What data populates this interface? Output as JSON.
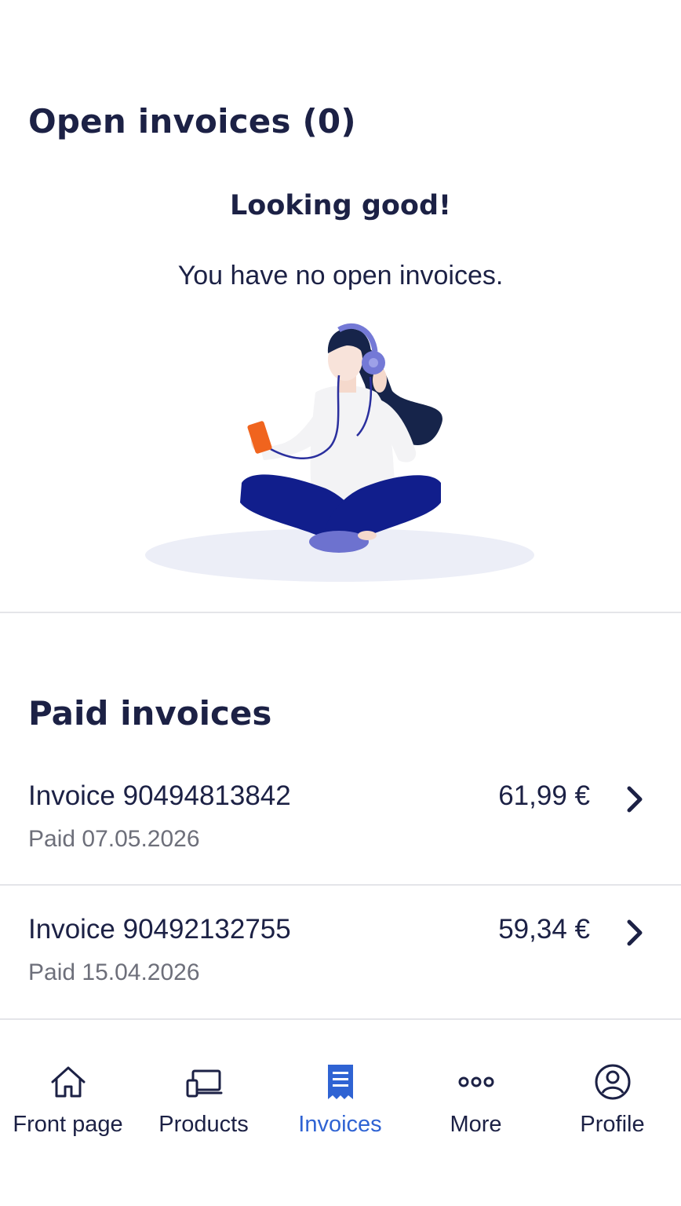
{
  "open_section": {
    "title": "Open invoices (0)",
    "empty_heading": "Looking good!",
    "empty_message": "You have no open invoices."
  },
  "paid_section": {
    "title": "Paid invoices",
    "invoices": [
      {
        "name": "Invoice 90494813842",
        "status": "Paid 07.05.2026",
        "amount": "61,99 €"
      },
      {
        "name": "Invoice 90492132755",
        "status": "Paid 15.04.2026",
        "amount": "59,34 €"
      }
    ]
  },
  "nav": {
    "active": "Invoices",
    "items": [
      {
        "label": "Front page",
        "icon": "home-icon"
      },
      {
        "label": "Products",
        "icon": "devices-icon"
      },
      {
        "label": "Invoices",
        "icon": "receipt-icon"
      },
      {
        "label": "More",
        "icon": "more-dots-icon"
      },
      {
        "label": "Profile",
        "icon": "user-circle-icon"
      }
    ]
  },
  "colors": {
    "text_primary": "#1c2145",
    "text_secondary": "#6d6f7a",
    "accent": "#2f63d3",
    "divider": "#e4e5e9"
  }
}
